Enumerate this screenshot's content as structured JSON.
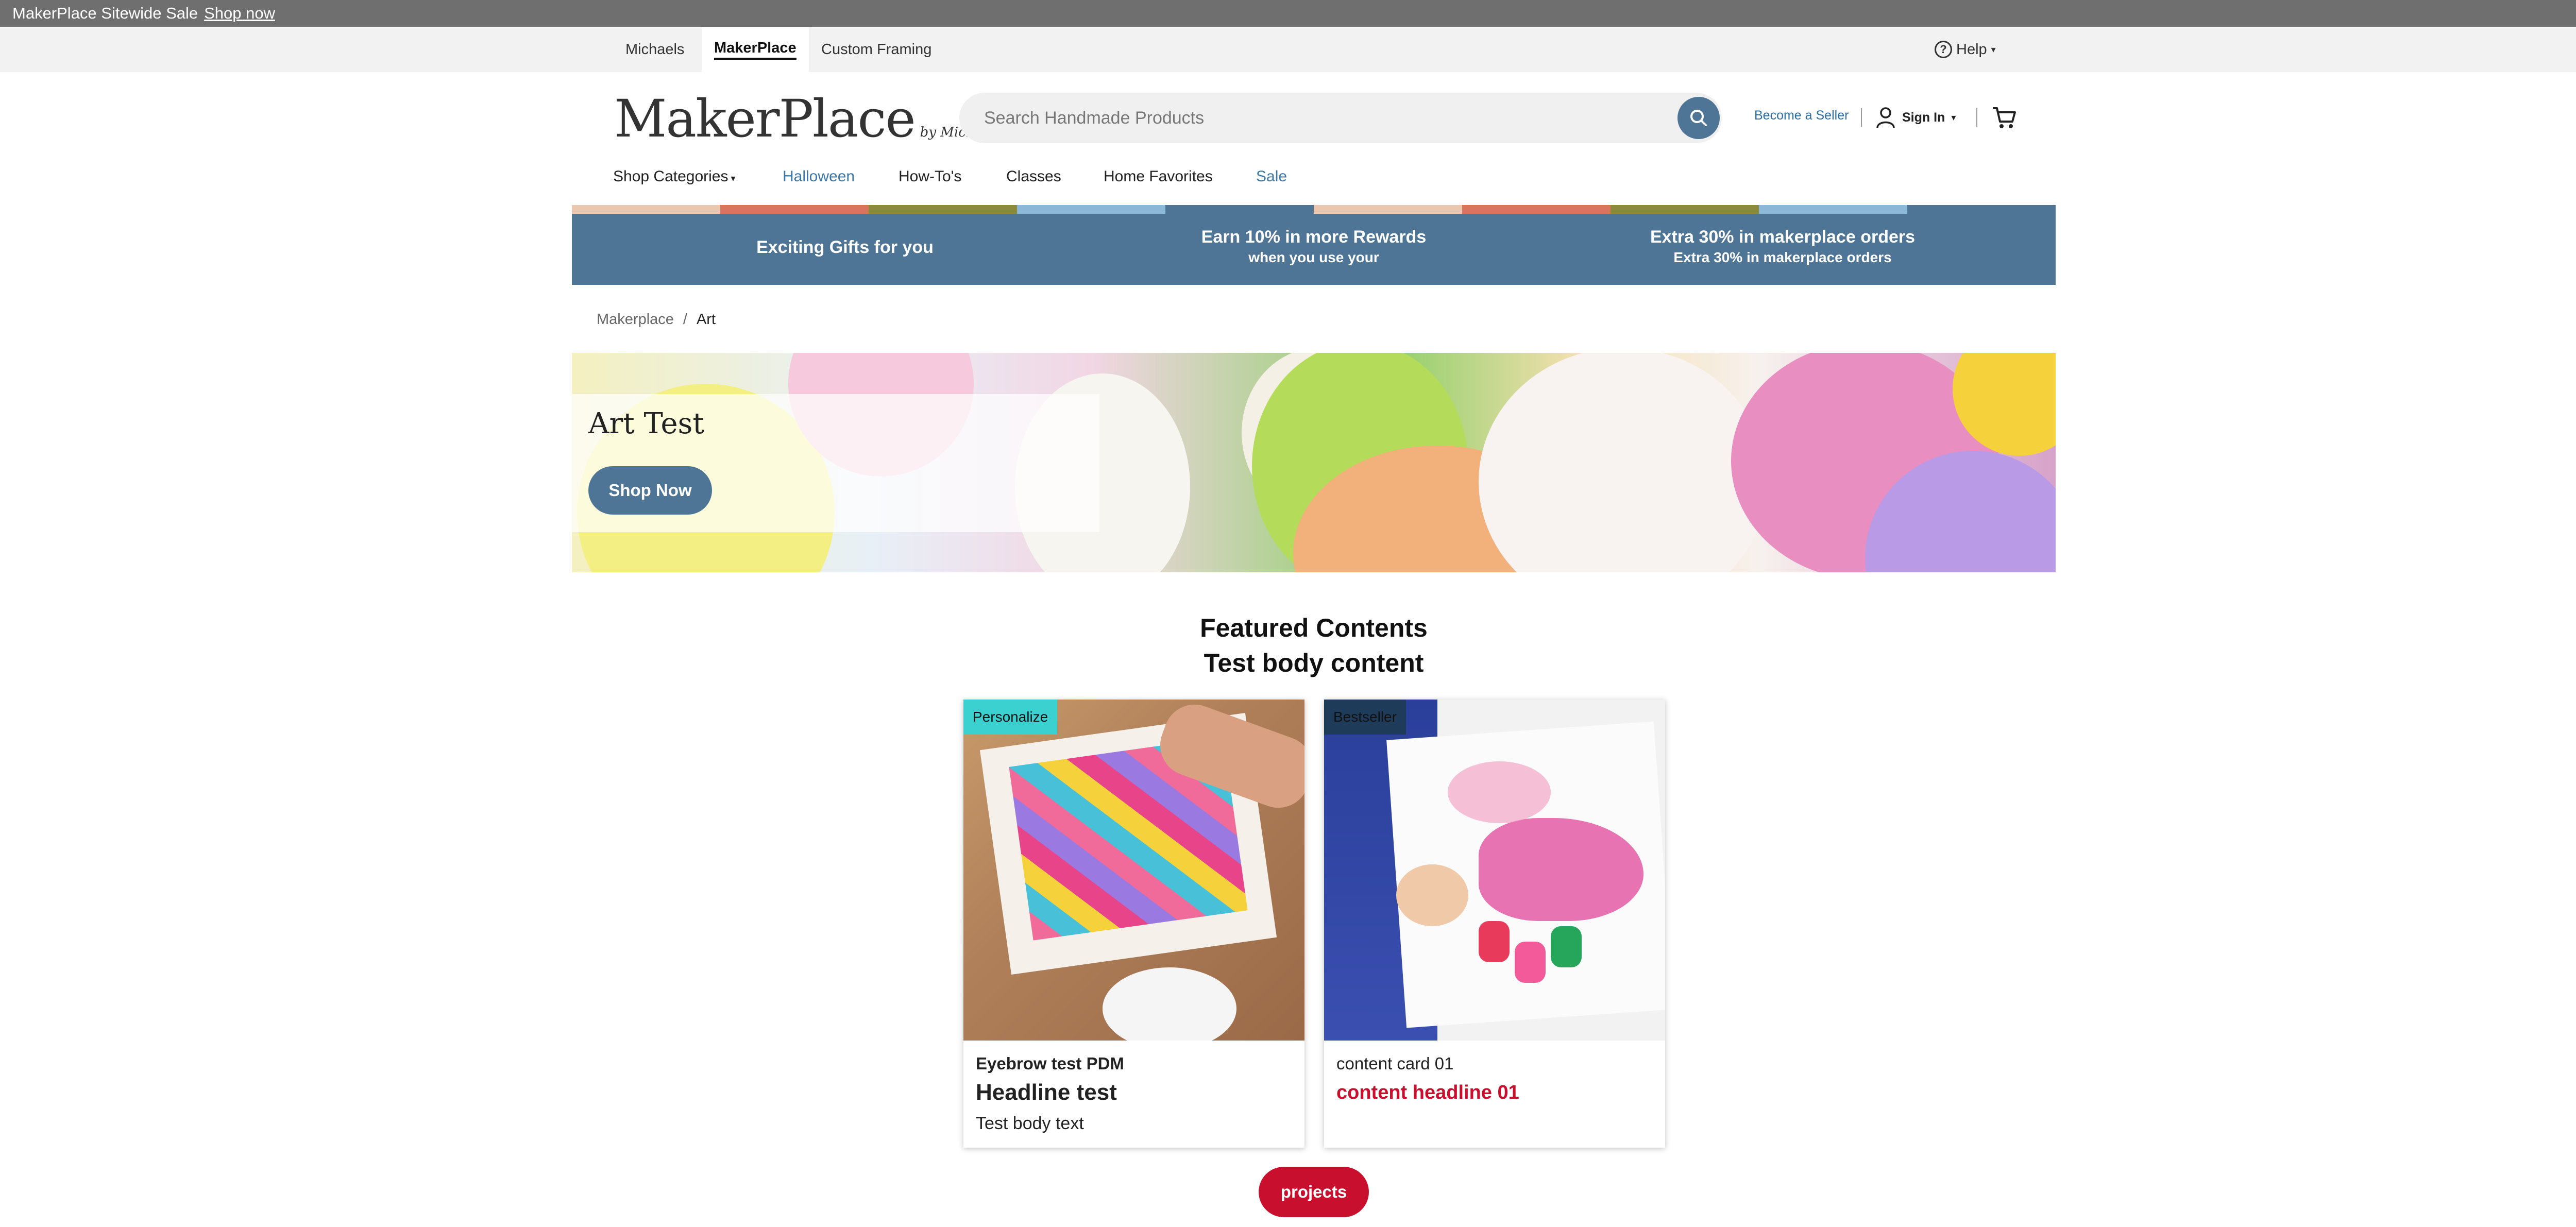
{
  "announcement": {
    "text": "MakerPlace Sitewide Sale",
    "link": "Shop now"
  },
  "site_tabs": [
    "Michaels",
    "MakerPlace",
    "Custom Framing"
  ],
  "help": {
    "label": "Help",
    "icon": "question-circle-icon"
  },
  "logo": {
    "main": "MakerPlace",
    "by": "by Michaels"
  },
  "search": {
    "placeholder": "Search Handmade Products",
    "icon": "search-icon"
  },
  "account": {
    "become_seller": "Become a Seller",
    "sign_in": "Sign In",
    "cart_icon": "cart-icon"
  },
  "nav": [
    "Shop Categories",
    "Halloween",
    "How-To's",
    "Classes",
    "Home Favorites",
    "Sale"
  ],
  "colors": {
    "accent": "#4e7595",
    "link_blue": "#3b78a6",
    "red": "#c8102e",
    "badge_teal": "#3bd1d1",
    "badge_navy": "#1f3b5a",
    "stripes": [
      "#ecc7b0",
      "#d9745d",
      "#8c8a3c",
      "#8bb8d6",
      "#4e7595",
      "#ecc7b0",
      "#d9745d",
      "#8c8a3c",
      "#4e7595",
      "#8bb8d6"
    ]
  },
  "promo": {
    "item1": {
      "title": "Exciting Gifts for you"
    },
    "item2": {
      "title": "Earn 10% in more Rewards",
      "sub": "when you use your"
    },
    "item3": {
      "title": "Extra 30% in makerplace orders",
      "sub": "Extra 30% in makerplace orders"
    }
  },
  "breadcrumb": {
    "root": "Makerplace",
    "sep": "/",
    "current": "Art"
  },
  "hero": {
    "title": "Art Test",
    "button": "Shop Now"
  },
  "featured": {
    "title": "Featured Contents",
    "subtitle": "Test body content"
  },
  "cards": [
    {
      "badge": "Personalize",
      "eyebrow": "Eyebrow test PDM",
      "headline": "Headline test",
      "body": "Test body text"
    },
    {
      "badge": "Bestseller",
      "eyebrow": "content card 01",
      "headline": "content headline 01",
      "body": ""
    }
  ],
  "projects_button": "projects"
}
